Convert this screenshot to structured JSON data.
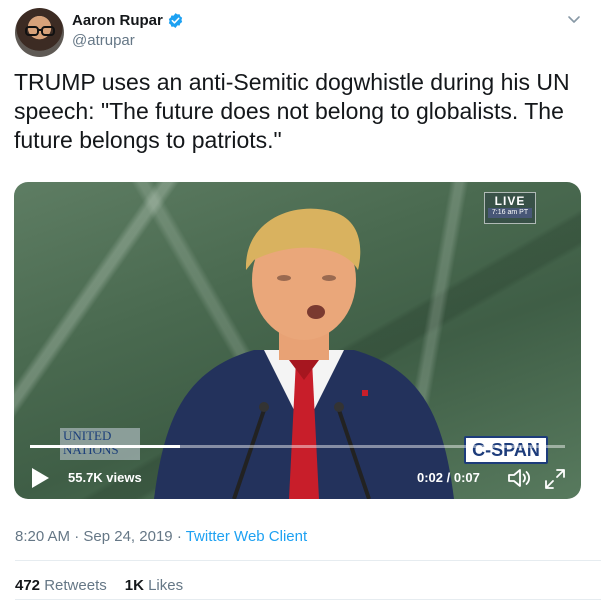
{
  "author": {
    "name": "Aaron Rupar",
    "handle": "@atrupar"
  },
  "tweet": {
    "text": "TRUMP uses an anti-Semitic dogwhistle during his UN speech: \"The future does not belong to globalists. The future belongs to patriots.\""
  },
  "video": {
    "live_label": "LIVE",
    "live_time": "7:16 am PT",
    "un_logo_line1": "UNITED",
    "un_logo_line2": "NATIONS",
    "network_logo": "C-SPAN",
    "views": "55.7K views",
    "timecode": "0:02 / 0:07",
    "progress_fraction": 0.28
  },
  "meta": {
    "time": "8:20 AM",
    "separator1": "·",
    "date": "Sep 24, 2019",
    "separator2": "·",
    "client": "Twitter Web Client"
  },
  "stats": {
    "retweets_count": "472",
    "retweets_label": "Retweets",
    "likes_count": "1K",
    "likes_label": "Likes"
  },
  "colors": {
    "link": "#1da1f2",
    "verified": "#1da1f2",
    "secondary_text": "#657786"
  },
  "icons": [
    "verified-badge-icon",
    "chevron-down-icon",
    "play-icon",
    "volume-icon",
    "fullscreen-icon"
  ]
}
